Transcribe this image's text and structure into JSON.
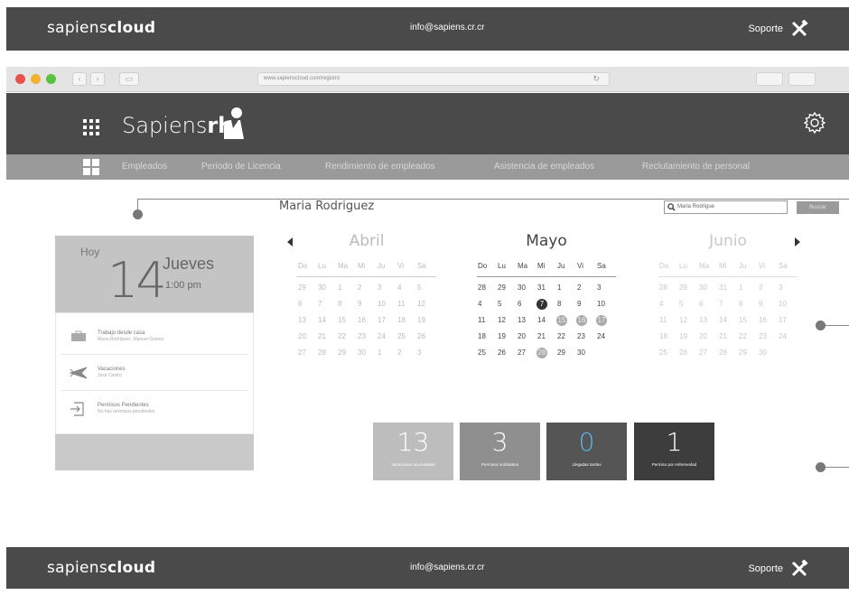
{
  "brand": {
    "prefix": "sapiens",
    "bold": "cloud"
  },
  "header_bar": {
    "email": "info@sapiens.cr.cr",
    "support_label": "Soporte"
  },
  "footer_bar": {
    "email": "info@sapiens.cr.cr",
    "support_label": "Soporte"
  },
  "browser": {
    "url": "www.sapienscloud.com/registro"
  },
  "app": {
    "title_light": "Sapiens",
    "title_bold": "rh"
  },
  "nav": {
    "items": [
      "Empleados",
      "Periodo de Licencia",
      "Rendimiento de empleados",
      "Asistencia de empleados",
      "Reclutamiento de personal"
    ]
  },
  "user": {
    "name": "Maria Rodriguez"
  },
  "search": {
    "value": "Maria Rodrigue",
    "button_label": "Buscar"
  },
  "today": {
    "label": "Hoy",
    "day": "14",
    "weekday": "Jueves",
    "time": "1:00 pm"
  },
  "agenda": [
    {
      "title": "Trabajo desde casa",
      "subtitle": "Maria Rodriguez, Manuel Gomez",
      "icon": "briefcase-icon"
    },
    {
      "title": "Vacaciones",
      "subtitle": "Jose Castro",
      "icon": "airplane-icon"
    },
    {
      "title": "Permisos Pendientes",
      "subtitle": "No hay permisos pendientes",
      "icon": "sign-in-icon"
    }
  ],
  "calendar": {
    "weekdays": [
      "Do",
      "Lu",
      "Ma",
      "Mi",
      "Ju",
      "Vi",
      "Sa"
    ],
    "months": [
      {
        "name": "Abril",
        "days": [
          "29",
          "30",
          "1",
          "2",
          "3",
          "4",
          "5",
          "6",
          "7",
          "8",
          "9",
          "10",
          "11",
          "12",
          "13",
          "14",
          "15",
          "16",
          "17",
          "18",
          "19",
          "20",
          "21",
          "22",
          "23",
          "24",
          "25",
          "26",
          "27",
          "28",
          "29",
          "30",
          "1",
          "2",
          "3"
        ]
      },
      {
        "name": "Mayo",
        "days": [
          "28",
          "29",
          "30",
          "31",
          "1",
          "2",
          "3",
          "4",
          "5",
          "6",
          "7",
          "8",
          "9",
          "10",
          "11",
          "12",
          "13",
          "14",
          "15",
          "16",
          "17",
          "18",
          "19",
          "20",
          "21",
          "22",
          "23",
          "24",
          "25",
          "26",
          "27",
          "28",
          "29",
          "30"
        ]
      },
      {
        "name": "Junio",
        "days": [
          "28",
          "29",
          "30",
          "31",
          "1",
          "2",
          "3",
          "4",
          "5",
          "6",
          "7",
          "8",
          "9",
          "10",
          "11",
          "12",
          "13",
          "14",
          "15",
          "16",
          "17",
          "18",
          "19",
          "20",
          "21",
          "22",
          "23",
          "24",
          "25",
          "26",
          "27",
          "28",
          "29",
          "30"
        ]
      }
    ]
  },
  "stats": [
    {
      "value": "13",
      "label": "Vacaciones acumuladas",
      "color": "#bdbdbd",
      "num_color": "#ffffff"
    },
    {
      "value": "3",
      "label": "Permisos solicitados",
      "color": "#8f8f8f",
      "num_color": "#ffffff"
    },
    {
      "value": "0",
      "label": "Llegadas tardes",
      "color": "#555555",
      "num_color": "#5bb8e8"
    },
    {
      "value": "1",
      "label": "Permiso por enfermedad",
      "color": "#3d3d3d",
      "num_color": "#ffffff"
    }
  ],
  "colors": {
    "dark_bar": "#4a4a4a",
    "nav_bar": "#9a9a9a",
    "panel": "#c9c9c9"
  }
}
